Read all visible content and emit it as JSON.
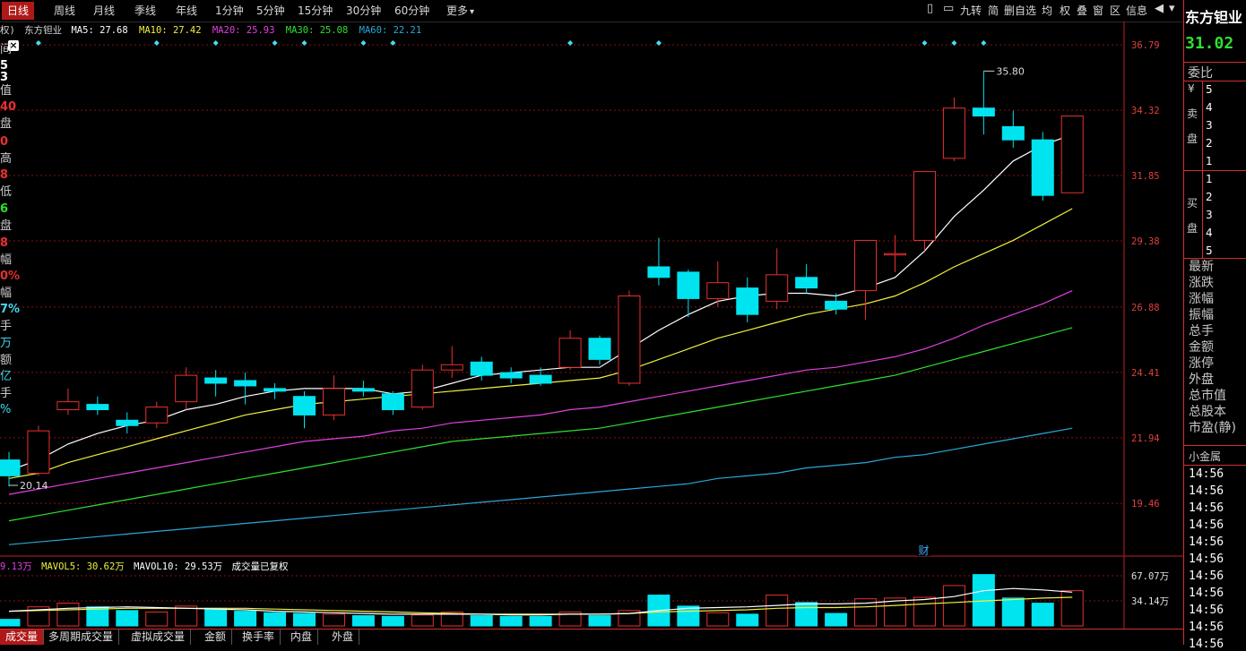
{
  "toolbar": {
    "periods": [
      "日线",
      "周线",
      "月线",
      "季线",
      "年线",
      "1分钟",
      "5分钟",
      "15分钟",
      "30分钟",
      "60分钟",
      "更多"
    ],
    "more_arrow": "▾",
    "tools": [
      "九转",
      "简",
      "删自选",
      "均",
      "权",
      "叠",
      "窗",
      "区",
      "信息"
    ],
    "icons": [
      "layout-icon",
      "window-icon",
      "back-icon",
      "menu-icon"
    ]
  },
  "ma_info": {
    "rights": "权)",
    "stock_name": "东方钽业",
    "ma5": "MA5: 27.68",
    "ma10": "MA10: 27.42",
    "ma20": "MA20: 25.93",
    "ma30": "MA30: 25.08",
    "ma60": "MA60: 22.21"
  },
  "colors": {
    "up": "#e83030",
    "down": "#00e4f0",
    "ma5": "#ffffff",
    "ma10": "#f0f040",
    "ma20": "#e040e0",
    "ma30": "#30e030",
    "ma60": "#2aa8d8",
    "grid": "#8a1010",
    "vol_ma5": "#ffffff",
    "vol_ma10": "#f0f040"
  },
  "price_axis": [
    "36.79",
    "34.32",
    "31.85",
    "29.38",
    "26.88",
    "24.41",
    "21.94",
    "19.46"
  ],
  "annotations": {
    "high": "35.80",
    "low": "20.14",
    "cai": "财"
  },
  "vol_info": {
    "vol": "9.13万",
    "mavol5": "MAVOL5: 30.62万",
    "mavol10": "MAVOL10: 29.53万",
    "note": "成交量已复权"
  },
  "vol_axis": [
    "67.07万",
    "34.14万"
  ],
  "left_stats": [
    "间",
    "5",
    "3",
    "值",
    "40",
    "盘",
    "0",
    "高",
    "8",
    "低",
    "6",
    "盘",
    "8",
    "幅",
    "0%",
    "幅",
    "7%",
    "手",
    "万",
    "额",
    "亿",
    "手",
    "%"
  ],
  "right_panel": {
    "name": "东方钽业",
    "price": "31.02",
    "weibi": "委比",
    "yen": "¥",
    "sell_label": [
      "卖",
      "盘"
    ],
    "sell_levels": [
      "5",
      "4",
      "3",
      "2",
      "1"
    ],
    "buy_label": [
      "买",
      "盘"
    ],
    "buy_levels": [
      "1",
      "2",
      "3",
      "4",
      "5"
    ],
    "fields": [
      "最新",
      "涨跌",
      "涨幅",
      "振幅",
      "总手",
      "金额",
      "涨停",
      "外盘",
      "总市值",
      "总股本",
      "市盈(静)"
    ],
    "sector": "小金属",
    "times": [
      "14:56",
      "14:56",
      "14:56",
      "14:56",
      "14:56",
      "14:56",
      "14:56",
      "14:56",
      "14:56",
      "14:56",
      "14:56"
    ]
  },
  "tabs": [
    "成交量",
    "多周期成交量",
    "虚拟成交量",
    "金额",
    "换手率",
    "内盘",
    "外盘"
  ],
  "chart_data": {
    "type": "candlestick",
    "price_range": [
      17.5,
      37.2
    ],
    "candles": [
      {
        "o": 21.1,
        "c": 20.5,
        "h": 21.4,
        "l": 20.1
      },
      {
        "o": 20.6,
        "c": 22.2,
        "h": 22.4,
        "l": 20.5
      },
      {
        "o": 23.0,
        "c": 23.3,
        "h": 23.8,
        "l": 22.8
      },
      {
        "o": 23.2,
        "c": 23.0,
        "h": 23.5,
        "l": 22.8
      },
      {
        "o": 22.6,
        "c": 22.4,
        "h": 22.9,
        "l": 22.1
      },
      {
        "o": 22.5,
        "c": 23.1,
        "h": 23.3,
        "l": 22.3
      },
      {
        "o": 23.3,
        "c": 24.3,
        "h": 24.6,
        "l": 23.0
      },
      {
        "o": 24.2,
        "c": 24.0,
        "h": 24.5,
        "l": 23.5
      },
      {
        "o": 24.1,
        "c": 23.9,
        "h": 24.4,
        "l": 23.2
      },
      {
        "o": 23.8,
        "c": 23.7,
        "h": 24.0,
        "l": 23.4
      },
      {
        "o": 23.5,
        "c": 22.8,
        "h": 23.7,
        "l": 22.3
      },
      {
        "o": 22.8,
        "c": 23.8,
        "h": 24.3,
        "l": 22.6
      },
      {
        "o": 23.8,
        "c": 23.7,
        "h": 24.1,
        "l": 23.5
      },
      {
        "o": 23.6,
        "c": 23.0,
        "h": 23.7,
        "l": 22.8
      },
      {
        "o": 23.1,
        "c": 24.5,
        "h": 24.7,
        "l": 23.0
      },
      {
        "o": 24.5,
        "c": 24.7,
        "h": 25.4,
        "l": 24.2
      },
      {
        "o": 24.8,
        "c": 24.3,
        "h": 25.0,
        "l": 24.1
      },
      {
        "o": 24.4,
        "c": 24.2,
        "h": 24.6,
        "l": 24.0
      },
      {
        "o": 24.3,
        "c": 24.0,
        "h": 24.6,
        "l": 23.9
      },
      {
        "o": 24.6,
        "c": 25.7,
        "h": 26.0,
        "l": 24.5
      },
      {
        "o": 25.7,
        "c": 24.9,
        "h": 25.8,
        "l": 24.7
      },
      {
        "o": 24.0,
        "c": 27.3,
        "h": 27.5,
        "l": 23.9
      },
      {
        "o": 28.4,
        "c": 28.0,
        "h": 29.5,
        "l": 27.7
      },
      {
        "o": 28.2,
        "c": 27.2,
        "h": 28.3,
        "l": 26.5
      },
      {
        "o": 27.2,
        "c": 27.8,
        "h": 28.6,
        "l": 26.9
      },
      {
        "o": 27.6,
        "c": 26.6,
        "h": 28.0,
        "l": 26.3
      },
      {
        "o": 27.1,
        "c": 28.1,
        "h": 29.1,
        "l": 26.8
      },
      {
        "o": 28.0,
        "c": 27.6,
        "h": 28.5,
        "l": 27.4
      },
      {
        "o": 27.1,
        "c": 26.8,
        "h": 27.4,
        "l": 26.6
      },
      {
        "o": 27.5,
        "c": 29.4,
        "h": 29.4,
        "l": 26.4
      },
      {
        "o": 28.9,
        "c": 28.9,
        "h": 29.6,
        "l": 28.2
      },
      {
        "o": 29.4,
        "c": 32.0,
        "h": 32.0,
        "l": 29.0
      },
      {
        "o": 32.5,
        "c": 34.4,
        "h": 34.8,
        "l": 32.4
      },
      {
        "o": 34.4,
        "c": 34.1,
        "h": 35.8,
        "l": 33.4
      },
      {
        "o": 33.7,
        "c": 33.2,
        "h": 34.3,
        "l": 32.9
      },
      {
        "o": 33.2,
        "c": 31.1,
        "h": 33.5,
        "l": 30.9
      },
      {
        "o": 31.2,
        "c": 34.1,
        "h": 34.1,
        "l": 31.2
      }
    ],
    "ma5": [
      20.7,
      21.1,
      21.7,
      22.1,
      22.4,
      22.6,
      23.0,
      23.2,
      23.5,
      23.7,
      23.8,
      23.8,
      23.8,
      23.6,
      23.7,
      24.0,
      24.3,
      24.4,
      24.5,
      24.6,
      24.6,
      25.3,
      26.0,
      26.6,
      27.1,
      27.3,
      27.4,
      27.4,
      27.3,
      27.6,
      28.0,
      29.0,
      30.3,
      31.3,
      32.4,
      33.0,
      33.4
    ],
    "ma10": [
      20.4,
      20.6,
      21.0,
      21.3,
      21.6,
      21.9,
      22.2,
      22.5,
      22.8,
      23.0,
      23.2,
      23.3,
      23.4,
      23.5,
      23.6,
      23.7,
      23.8,
      23.9,
      24.0,
      24.1,
      24.2,
      24.5,
      24.9,
      25.3,
      25.7,
      26.0,
      26.3,
      26.6,
      26.8,
      27.0,
      27.3,
      27.8,
      28.4,
      28.9,
      29.4,
      30.0,
      30.6
    ],
    "ma20": [
      19.8,
      20.0,
      20.2,
      20.4,
      20.6,
      20.8,
      21.0,
      21.2,
      21.4,
      21.6,
      21.8,
      21.9,
      22.0,
      22.2,
      22.3,
      22.5,
      22.6,
      22.7,
      22.8,
      23.0,
      23.1,
      23.3,
      23.5,
      23.7,
      23.9,
      24.1,
      24.3,
      24.5,
      24.6,
      24.8,
      25.0,
      25.3,
      25.7,
      26.2,
      26.6,
      27.0,
      27.5
    ],
    "ma30": [
      18.8,
      19.0,
      19.2,
      19.4,
      19.6,
      19.8,
      20.0,
      20.2,
      20.4,
      20.6,
      20.8,
      21.0,
      21.2,
      21.4,
      21.6,
      21.8,
      21.9,
      22.0,
      22.1,
      22.2,
      22.3,
      22.5,
      22.7,
      22.9,
      23.1,
      23.3,
      23.5,
      23.7,
      23.9,
      24.1,
      24.3,
      24.6,
      24.9,
      25.2,
      25.5,
      25.8,
      26.1
    ],
    "ma60": [
      17.9,
      18.0,
      18.1,
      18.2,
      18.3,
      18.4,
      18.5,
      18.6,
      18.7,
      18.8,
      18.9,
      19.0,
      19.1,
      19.2,
      19.3,
      19.4,
      19.5,
      19.6,
      19.7,
      19.8,
      19.9,
      20.0,
      20.1,
      20.2,
      20.4,
      20.5,
      20.6,
      20.8,
      20.9,
      21.0,
      21.2,
      21.3,
      21.5,
      21.7,
      21.9,
      22.1,
      22.3
    ],
    "volume_range": [
      0,
      72
    ],
    "volume": [
      9,
      26,
      31,
      26,
      21,
      19,
      27,
      24,
      20,
      18,
      17,
      16,
      14,
      13,
      15,
      19,
      14,
      13,
      13,
      19,
      14,
      21,
      42,
      27,
      18,
      16,
      42,
      32,
      17,
      37,
      38,
      39,
      55,
      70,
      38,
      31,
      48
    ],
    "vol_ma5": [
      20,
      22,
      24,
      25,
      26,
      25,
      24,
      23,
      22,
      20,
      19,
      18,
      17,
      16,
      16,
      16,
      16,
      15,
      15,
      16,
      16,
      17,
      21,
      24,
      25,
      26,
      28,
      30,
      30,
      31,
      34,
      36,
      40,
      48,
      51,
      49,
      46
    ],
    "vol_ma10": [
      20,
      21,
      22,
      23,
      24,
      24,
      24,
      24,
      24,
      23,
      22,
      21,
      20,
      19,
      18,
      17,
      16,
      16,
      16,
      16,
      16,
      17,
      19,
      20,
      21,
      22,
      24,
      25,
      25,
      26,
      28,
      30,
      32,
      34,
      36,
      38,
      39
    ],
    "markers_idx": [
      1,
      5,
      7,
      9,
      10,
      12,
      13,
      19,
      22,
      31,
      32,
      33
    ]
  }
}
